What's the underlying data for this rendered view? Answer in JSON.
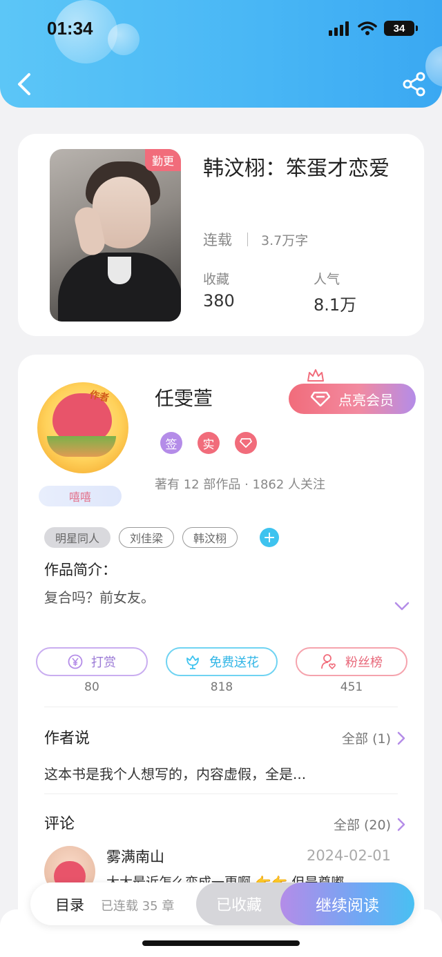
{
  "status_bar": {
    "time": "01:34",
    "battery": "34"
  },
  "book": {
    "update_tag": "勤更",
    "title": "韩汶栩：笨蛋才恋爱",
    "status": "连载",
    "words": "3.7万字",
    "stats": [
      {
        "label": "收藏",
        "value": "380"
      },
      {
        "label": "人气",
        "value": "8.1万"
      }
    ]
  },
  "author": {
    "avatar_badge": "作者",
    "avatar_pill": "嘻嘻",
    "name": "任雯萱",
    "vip_label": "点亮会员",
    "badges": [
      {
        "text": "签",
        "color": "#b48ce8"
      },
      {
        "text": "实",
        "color": "#f16c7b"
      },
      {
        "text": "◇",
        "color": "#f16c7b"
      }
    ],
    "meta": "著有 12 部作品 · 1862 人关注"
  },
  "tags": [
    "明星同人",
    "刘佳梁",
    "韩汶栩"
  ],
  "tag_add": "+",
  "intro": {
    "label": "作品简介：",
    "text": "复合吗？前女友。"
  },
  "actions": [
    {
      "label": "打赏",
      "count": "80",
      "color": "#b48ce8"
    },
    {
      "label": "免费送花",
      "count": "818",
      "color": "#3ec3ef"
    },
    {
      "label": "粉丝榜",
      "count": "451",
      "color": "#f16c7b"
    }
  ],
  "author_says": {
    "title": "作者说",
    "more": "全部 (1)",
    "text": "这本书是我个人想写的，内容虚假，全是..."
  },
  "comments": {
    "title": "评论",
    "more": "全部 (20)",
    "items": [
      {
        "name": "雾满南山",
        "date": "2024-02-01",
        "text": "大大最近怎么变成一更啊 👉👉 但是尊嘟"
      }
    ]
  },
  "bottom": {
    "toc": "目录",
    "toc_sub": "已连载 35 章",
    "fav": "已收藏",
    "read": "继续阅读"
  }
}
